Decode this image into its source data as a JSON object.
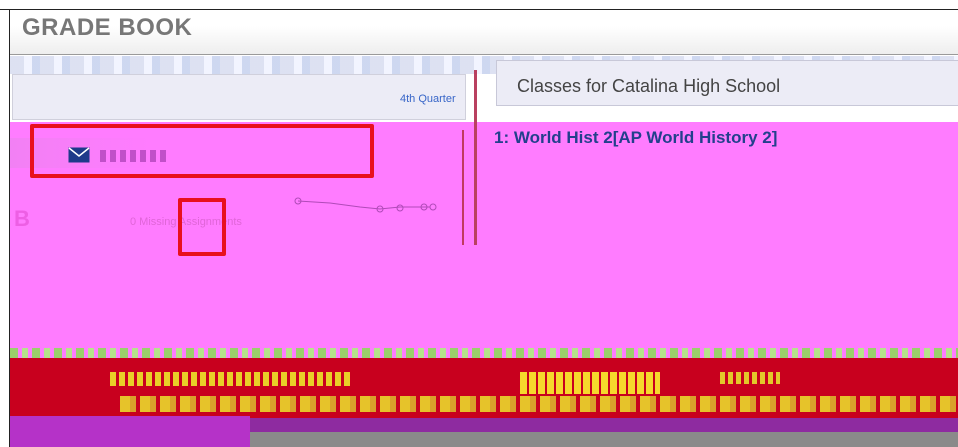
{
  "page": {
    "title": "GRADE BOOK"
  },
  "quarter": {
    "label": "4th Quarter"
  },
  "classes": {
    "title": "Classes for Catalina High School",
    "selected_course": "1: World Hist 2[AP World History 2]"
  },
  "student": {
    "grade": "B",
    "missing": "0 Missing Assignments"
  },
  "icons": {
    "mail": "envelope-icon"
  },
  "colors": {
    "annotation": "#e8101e",
    "corrupted_region": "#ff7cff",
    "link": "#23408c",
    "quarter_link": "#3866c8"
  }
}
